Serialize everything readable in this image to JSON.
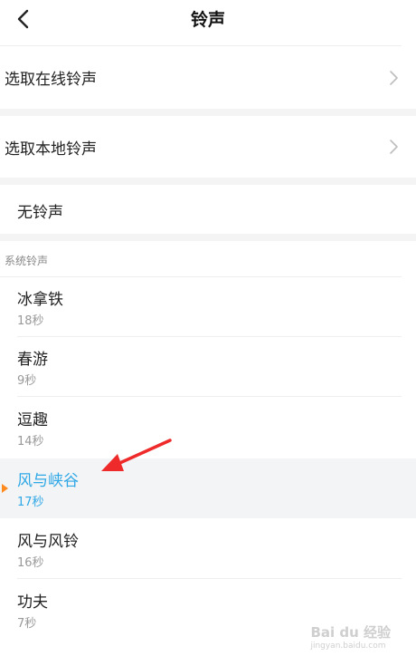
{
  "header": {
    "title": "铃声"
  },
  "options": {
    "online": "选取在线铃声",
    "local": "选取本地铃声",
    "none": "无铃声"
  },
  "section": {
    "label": "系统铃声"
  },
  "ringtones": [
    {
      "name": "冰拿铁",
      "duration": "18秒"
    },
    {
      "name": "春游",
      "duration": "9秒"
    },
    {
      "name": "逗趣",
      "duration": "14秒"
    },
    {
      "name": "风与峡谷",
      "duration": "17秒",
      "selected": true
    },
    {
      "name": "风与风铃",
      "duration": "16秒"
    },
    {
      "name": "功夫",
      "duration": "7秒"
    }
  ],
  "colors": {
    "selected_text": "#2fa8e6",
    "play_marker": "#ff8a1e",
    "annotation_arrow": "#ee2a2a"
  },
  "watermark": {
    "brand": "Bai du 经验",
    "sub": "jingyan.baidu.com"
  }
}
